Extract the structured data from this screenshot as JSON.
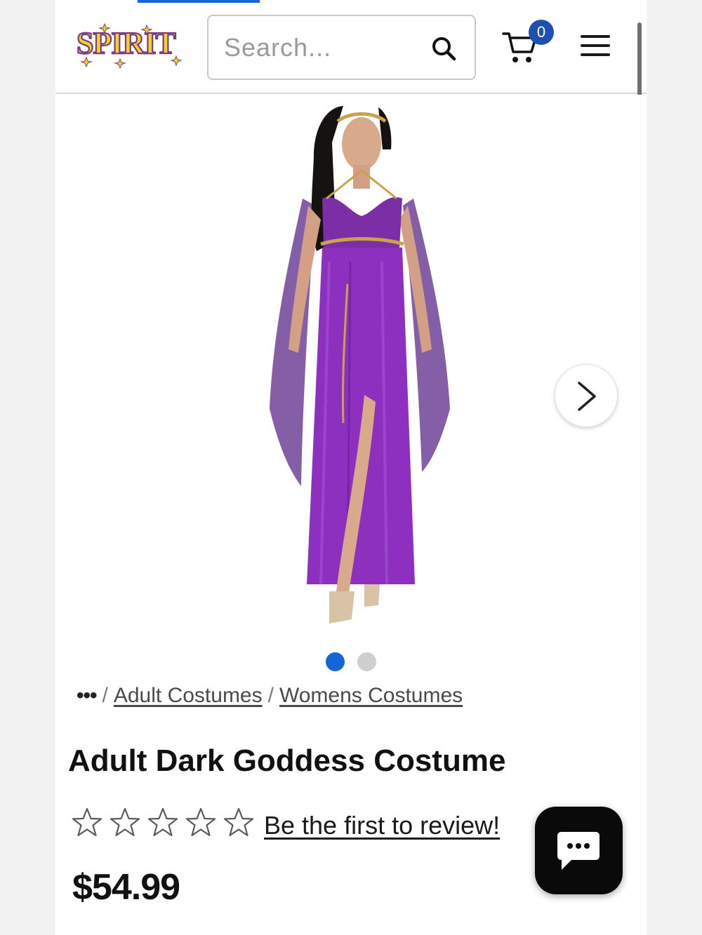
{
  "brand": {
    "name": "SPIRIT",
    "accent_color": "#1565d8"
  },
  "header": {
    "search_placeholder": "Search...",
    "cart_count": "0",
    "icons": [
      "search-icon",
      "cart-icon",
      "menu-icon"
    ]
  },
  "gallery": {
    "image_count": 2,
    "active_index": 0,
    "next_icon": "chevron-right-icon"
  },
  "breadcrumb": {
    "ellipsis": "•••",
    "items": [
      "Adult Costumes",
      "Womens Costumes"
    ]
  },
  "product": {
    "title": "Adult Dark Goddess Costume",
    "rating_stars": 0,
    "rating_max": 5,
    "review_link": "Be the first to review!",
    "price": "$54.99"
  },
  "chat": {
    "icon": "chat-bubble-icon"
  }
}
